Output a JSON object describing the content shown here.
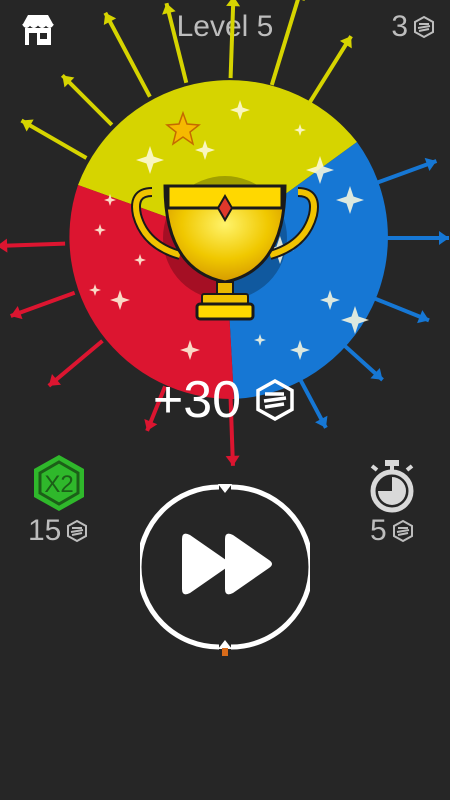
{
  "header": {
    "shop_icon": "shop-icon",
    "level_title": "Level 5",
    "gem_count": "3",
    "gem_icon": "gem-icon"
  },
  "board": {
    "segments": [
      "yellow",
      "blue",
      "red"
    ],
    "colors": {
      "yellow": "#d6d400",
      "blue": "#1677d4",
      "red": "#dc1530",
      "background": "#262626"
    },
    "trophy_icon": "trophy-icon",
    "star_icon": "star-icon"
  },
  "reward": {
    "text": "+30",
    "icon": "gem-icon"
  },
  "boosters": {
    "double": {
      "label": "X2",
      "cost": "15",
      "color": "#2fb82b"
    },
    "timer": {
      "icon": "stopwatch-icon",
      "cost": "5"
    }
  },
  "next_button": {
    "icon": "fast-forward-icon"
  }
}
